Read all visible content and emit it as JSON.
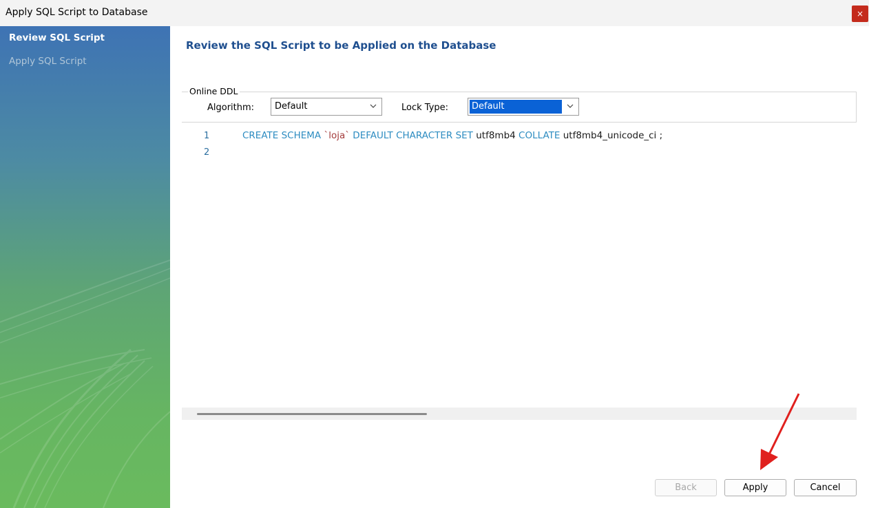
{
  "window": {
    "title": "Apply SQL Script to Database",
    "close_glyph": "×"
  },
  "sidebar": {
    "items": [
      {
        "label": "Review SQL Script",
        "active": true
      },
      {
        "label": "Apply SQL Script",
        "active": false
      }
    ]
  },
  "main": {
    "heading": "Review the SQL Script to be Applied on the Database",
    "online_ddl": {
      "legend": "Online DDL",
      "algorithm_label": "Algorithm:",
      "algorithm_value": "Default",
      "lock_type_label": "Lock Type:",
      "lock_type_value": "Default"
    },
    "editor": {
      "line_numbers": [
        "1",
        "2"
      ],
      "line1": {
        "create_schema": "CREATE SCHEMA",
        "schema_name": "`loja`",
        "default_charset": "DEFAULT CHARACTER SET",
        "charset": "utf8mb4",
        "collate": "COLLATE",
        "collation": "utf8mb4_unicode_ci ;"
      }
    }
  },
  "footer": {
    "back_label": "Back",
    "apply_label": "Apply",
    "cancel_label": "Cancel"
  },
  "colors": {
    "accent_heading": "#1f4f8f",
    "keyword": "#2d8cc1",
    "string": "#a43c3c",
    "annotation_arrow": "#e0201e"
  }
}
